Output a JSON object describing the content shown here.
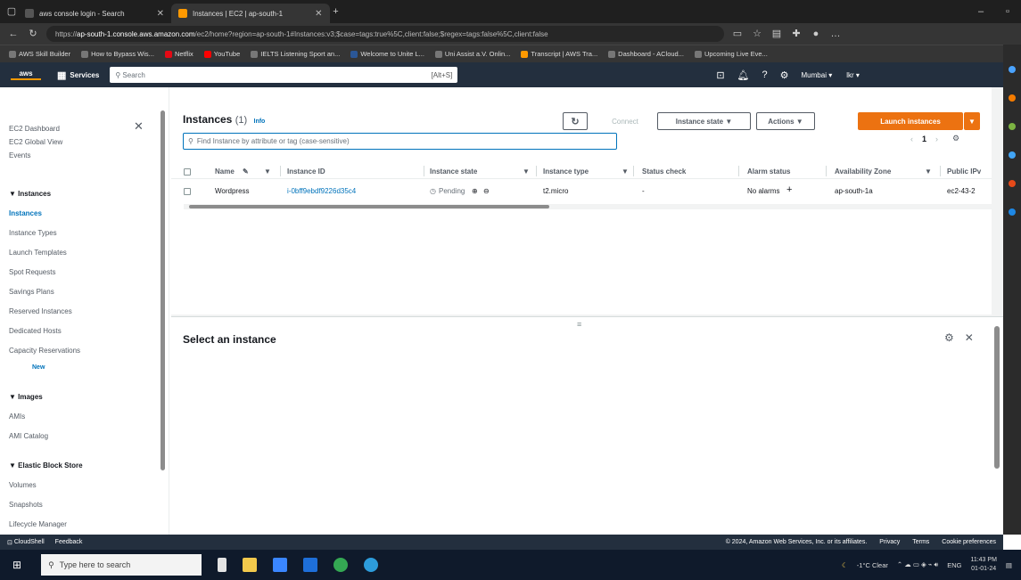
{
  "browser": {
    "tabs": [
      {
        "title": "aws console login - Search",
        "active": false
      },
      {
        "title": "Instances | EC2 | ap-south-1",
        "active": true
      }
    ],
    "url_prefix": "https://",
    "url_host": "ap-south-1.console.aws.amazon.com",
    "url_rest": "/ec2/home?region=ap-south-1#Instances:v3;$case=tags:true%5C,client:false;$regex=tags:false%5C,client:false",
    "bookmarks": [
      "AWS Skill Builder",
      "How to Bypass Wis...",
      "Netflix",
      "YouTube",
      "IELTS Listening Sport an...",
      "Welcome to Unite L...",
      "Uni Assist a.V. Onlin...",
      "Transcript | AWS Tra...",
      "Dashboard - ACloud...",
      "Upcoming Live Eve..."
    ]
  },
  "aws_header": {
    "logo": "aws",
    "services_label": "Services",
    "search_placeholder": "Search",
    "search_shortcut": "[Alt+S]",
    "region": "Mumbai ▾",
    "account": "lkr ▾"
  },
  "sidebar": {
    "top_items": [
      "EC2 Dashboard",
      "EC2 Global View",
      "Events"
    ],
    "sections": [
      {
        "title": "▼ Instances",
        "items": [
          "Instances",
          "Instance Types",
          "Launch Templates",
          "Spot Requests",
          "Savings Plans",
          "Reserved Instances",
          "Dedicated Hosts",
          "Capacity Reservations"
        ],
        "new_badge": "New"
      },
      {
        "title": "▼ Images",
        "items": [
          "AMIs",
          "AMI Catalog"
        ]
      },
      {
        "title": "▼ Elastic Block Store",
        "items": [
          "Volumes",
          "Snapshots",
          "Lifecycle Manager"
        ]
      }
    ],
    "active_item": "Instances"
  },
  "instances_panel": {
    "title": "Instances",
    "count": "(1)",
    "info": "Info",
    "connect_label": "Connect",
    "instance_state_label": "Instance state ▼",
    "actions_label": "Actions ▼",
    "launch_label": "Launch instances",
    "filter_placeholder": "Find Instance by attribute or tag (case-sensitive)",
    "page": "1",
    "columns": [
      "Name",
      "Instance ID",
      "Instance state",
      "Instance type",
      "Status check",
      "Alarm status",
      "Availability Zone",
      "Public IPv"
    ],
    "rows": [
      {
        "name": "Wordpress",
        "instance_id": "i-0bff9ebdf9226d35c4",
        "state": "Pending",
        "type": "t2.micro",
        "status_check": "-",
        "alarm": "No alarms",
        "az": "ap-south-1a",
        "public": "ec2-43-2"
      }
    ]
  },
  "detail_panel": {
    "title": "Select an instance"
  },
  "footer": {
    "cloudshell": "CloudShell",
    "feedback": "Feedback",
    "copyright": "© 2024, Amazon Web Services, Inc. or its affiliates.",
    "privacy": "Privacy",
    "terms": "Terms",
    "cookies": "Cookie preferences"
  },
  "taskbar": {
    "search_placeholder": "Type here to search",
    "weather": "-1°C Clear",
    "lang": "ENG",
    "time": "11:43 PM",
    "date": "01-01-24"
  },
  "colors": {
    "aws_nav": "#232f3e",
    "launch_button": "#ec7211",
    "link": "#0073bb"
  }
}
